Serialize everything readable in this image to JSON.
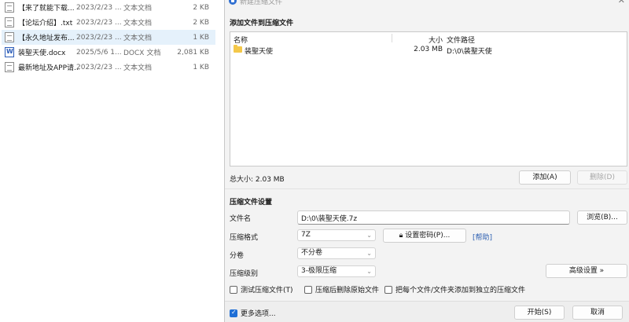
{
  "explorer": {
    "files": [
      {
        "name": "【来了就能下载...",
        "date": "2023/2/23 ...",
        "type": "文本文档",
        "size": "2 KB",
        "icon": "txt-file-icon",
        "selected": false
      },
      {
        "name": "【论坛介绍】.txt",
        "date": "2023/2/23 ...",
        "type": "文本文档",
        "size": "2 KB",
        "icon": "txt-file-icon",
        "selected": false
      },
      {
        "name": "【永久地址发布...",
        "date": "2023/2/23 ...",
        "type": "文本文档",
        "size": "1 KB",
        "icon": "txt-file-icon",
        "selected": true
      },
      {
        "name": "装聖天使.docx",
        "date": "2025/5/6 1...",
        "type": "DOCX 文档",
        "size": "2,081 KB",
        "icon": "docx-file-icon",
        "selected": false
      },
      {
        "name": "最新地址及APP请...",
        "date": "2023/2/23 ...",
        "type": "文本文档",
        "size": "1 KB",
        "icon": "txt-file-icon",
        "selected": false
      }
    ]
  },
  "dialog": {
    "title": "新建压缩文件",
    "add_section_title": "添加文件到压缩文件",
    "list": {
      "col_name": "名称",
      "col_size": "大小",
      "col_path": "文件路径",
      "entries": [
        {
          "name": "装聖天使",
          "size": "2.03 MB",
          "path": "D:\\0\\装聖天使",
          "icon": "folder-icon"
        }
      ]
    },
    "total_size": "总大小: 2.03 MB",
    "add_button": "添加(A)",
    "delete_button": "删除(D)",
    "settings_title": "压缩文件设置",
    "filename_label": "文件名",
    "filename_value": "D:\\0\\装聖天使.7z",
    "browse_button": "浏览(B)...",
    "format_label": "压缩格式",
    "format_value": "7Z",
    "password_button": "设置密码(P)...",
    "help_link": "[帮助]",
    "volume_label": "分卷",
    "volume_value": "不分卷",
    "level_label": "压缩级别",
    "level_value": "3-极限压缩",
    "advanced_button": "高级设置 »",
    "test_label": "测试压缩文件(T)",
    "test_checked": false,
    "delete_after_label": "压缩后删除原始文件",
    "delete_after_checked": false,
    "separate_label": "把每个文件/文件夹添加到独立的压缩文件",
    "separate_checked": false,
    "more_options_label": "更多选项...",
    "more_options_checked": true,
    "start_button": "开始(S)",
    "cancel_button": "取消",
    "accent_color": "#1f6fd6"
  }
}
